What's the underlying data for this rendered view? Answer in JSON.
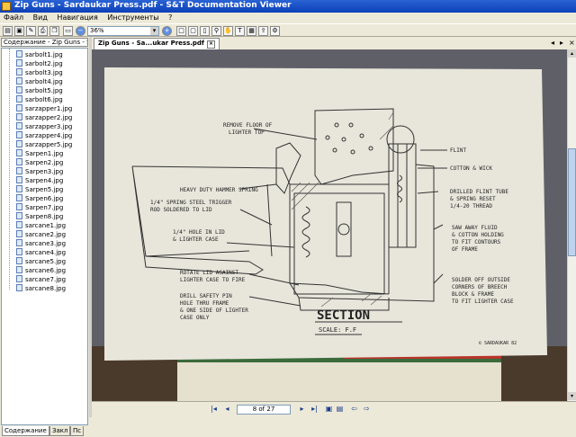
{
  "window": {
    "title": "Zip Guns - Sardaukar Press.pdf - S&T Documentation Viewer"
  },
  "menu": [
    "Файл",
    "Вид",
    "Навигация",
    "Инструменты",
    "?"
  ],
  "toolbar": {
    "zoom_value": "36%"
  },
  "left_panel": {
    "header": "Содержание - Zip Guns - Sardaukar Press.pdf",
    "items": [
      "sarbolt1.jpg",
      "sarbolt2.jpg",
      "sarbolt3.jpg",
      "sarbolt4.jpg",
      "sarbolt5.jpg",
      "sarbolt6.jpg",
      "sarzapper1.jpg",
      "sarzapper2.jpg",
      "sarzapper3.jpg",
      "sarzapper4.jpg",
      "sarzapper5.jpg",
      "Sarpen1.jpg",
      "Sarpen2.jpg",
      "Sarpen3.jpg",
      "Sarpen4.jpg",
      "Sarpen5.jpg",
      "Sarpen6.jpg",
      "Sarpen7.jpg",
      "Sarpen8.jpg",
      "sarcane1.jpg",
      "sarcane2.jpg",
      "sarcane3.jpg",
      "sarcane4.jpg",
      "sarcane5.jpg",
      "sarcane6.jpg",
      "sarcane7.jpg",
      "sarcane8.jpg"
    ],
    "tabs": [
      "Содержание",
      "Закл",
      "Пс"
    ]
  },
  "document_tab": {
    "label": "Zip Guns - Sa...ukar Press.pdf"
  },
  "drawing": {
    "labels": [
      "REMOVE FLOOR OF",
      "LIGHTER TOP",
      "FLINT",
      "COTTON & WICK",
      "HEAVY DUTY HAMMER SPRING",
      "1/4\" SPRING STEEL TRIGGER",
      "ROD SOLDERED TO LID",
      "DRILLED FLINT TUBE",
      "& SPRING RESET",
      "1/4-20 THREAD",
      "1/4\" HOLE IN LID",
      "& LIGHTER CASE",
      "SAW AWAY FLUID",
      "& COTTON HOLDING",
      "TO FIT CONTOURS",
      "OF FRAME",
      "ROTATE LID AGAINST",
      "LIGHTER CASE TO FIRE",
      "DRILL SAFETY PIN",
      "HOLE THRU FRAME",
      "& ONE SIDE OF LIGHTER",
      "CASE ONLY",
      "SOLDER OFF OUTSIDE",
      "CORNERS OF BREECH",
      "BLOCK & FRAME",
      "TO FIT LIGHTER CASE",
      "SECTION",
      "SCALE: F.F",
      "© SARDAUKAR 82"
    ]
  },
  "status": {
    "page_indicator": "8 of 27"
  }
}
